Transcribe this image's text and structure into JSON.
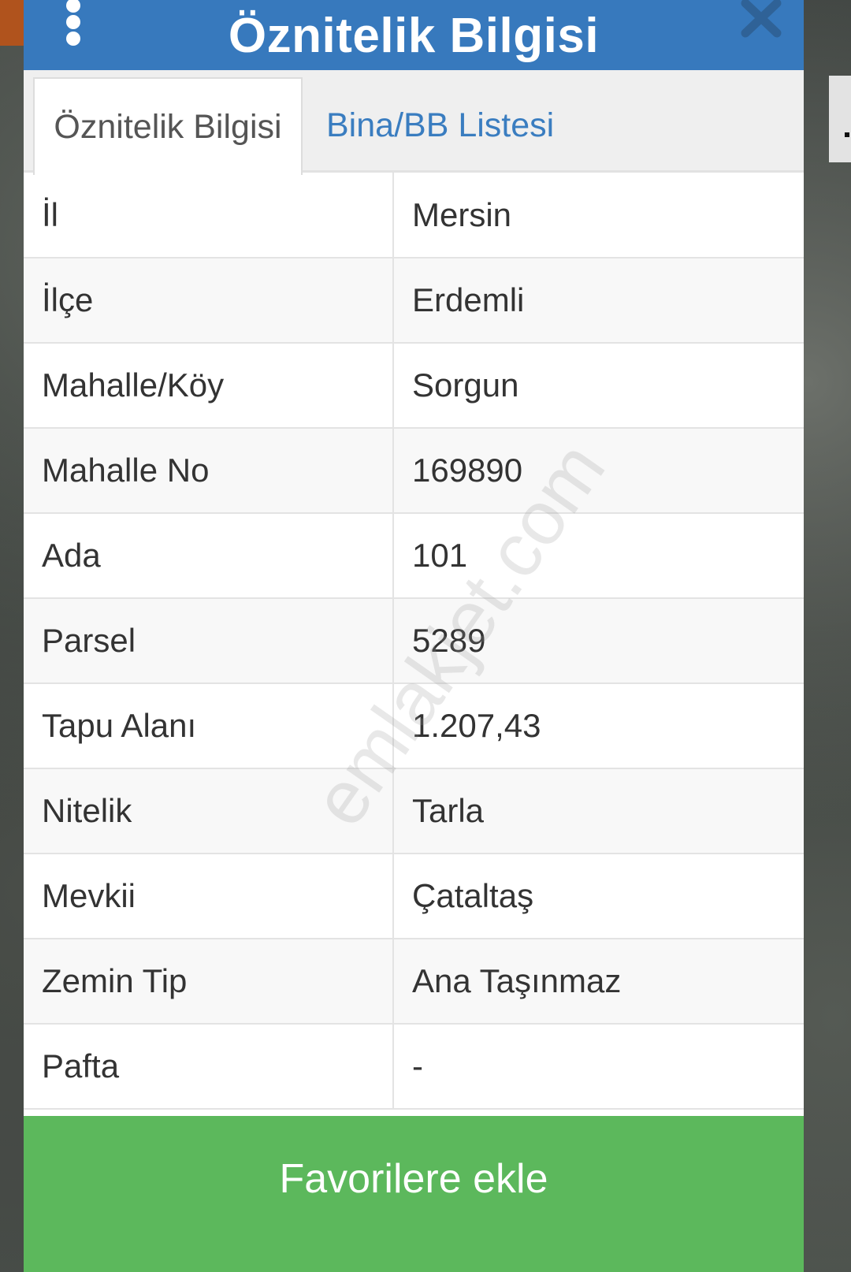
{
  "header": {
    "title": "Öznitelik Bilgisi",
    "menu_icon": "kebab-menu-icon",
    "close_icon": "close-icon"
  },
  "tabs": [
    {
      "label": "Öznitelik Bilgisi",
      "active": true
    },
    {
      "label": "Bina/BB Listesi",
      "active": false
    }
  ],
  "attributes": [
    {
      "key": "İl",
      "value": "Mersin"
    },
    {
      "key": "İlçe",
      "value": "Erdemli"
    },
    {
      "key": "Mahalle/Köy",
      "value": "Sorgun"
    },
    {
      "key": "Mahalle No",
      "value": "169890"
    },
    {
      "key": "Ada",
      "value": "101"
    },
    {
      "key": "Parsel",
      "value": "5289"
    },
    {
      "key": "Tapu Alanı",
      "value": "1.207,43"
    },
    {
      "key": "Nitelik",
      "value": "Tarla"
    },
    {
      "key": "Mevkii",
      "value": "Çataltaş"
    },
    {
      "key": "Zemin Tip",
      "value": "Ana Taşınmaz"
    },
    {
      "key": "Pafta",
      "value": "-"
    }
  ],
  "watermark": "emlakjet.com",
  "footer": {
    "favorite_label": "Favorilere ekle"
  },
  "colors": {
    "header": "#3779bd",
    "tab_link": "#3a7dc0",
    "button": "#5cb85c"
  }
}
